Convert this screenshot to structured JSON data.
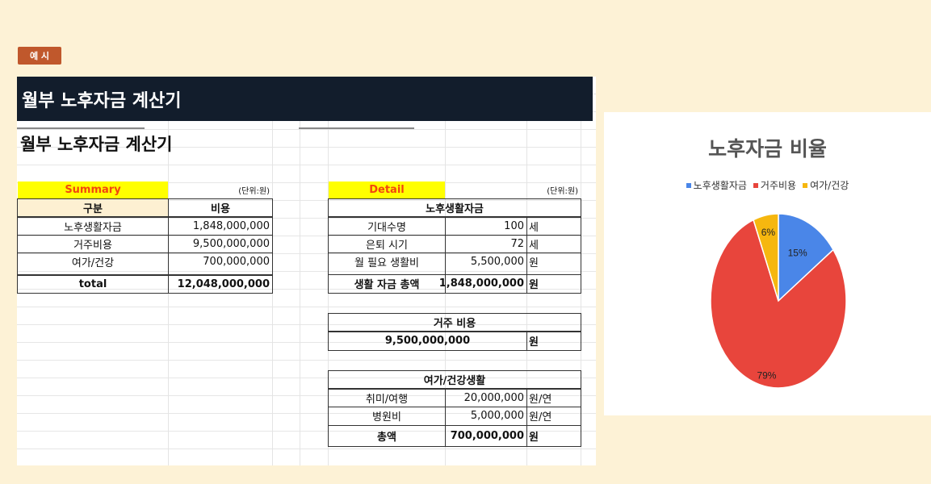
{
  "badge": "예 시",
  "sheet": {
    "banner_title": "월부 노후자금 계산기",
    "sub_title": "월부 노후자금 계산기"
  },
  "summary": {
    "header": "Summary",
    "unit": "(단위:원)",
    "col1": "구분",
    "col2": "비용",
    "rows": [
      {
        "label": "노후생활자금",
        "value": "1,848,000,000"
      },
      {
        "label": "거주비용",
        "value": "9,500,000,000"
      },
      {
        "label": "여가/건강",
        "value": "700,000,000"
      }
    ],
    "total_label": "total",
    "total_value": "12,048,000,000"
  },
  "detail": {
    "header": "Detail",
    "unit": "(단위:원)",
    "living": {
      "title": "노후생활자금",
      "rows": [
        {
          "label": "기대수명",
          "value": "100",
          "unit": "세"
        },
        {
          "label": "은퇴 시기",
          "value": "72",
          "unit": "세"
        },
        {
          "label": "월 필요 생활비",
          "value": "5,500,000",
          "unit": "원"
        }
      ],
      "total_label": "생활 자금 총액",
      "total_value": "1,848,000,000",
      "total_unit": "원"
    },
    "housing": {
      "title": "거주 비용",
      "value": "9,500,000,000",
      "unit": "원"
    },
    "leisure": {
      "title": "여가/건강생활",
      "rows": [
        {
          "label": "취미/여행",
          "value": "20,000,000",
          "unit": "원/연"
        },
        {
          "label": "병원비",
          "value": "5,000,000",
          "unit": "원/연"
        }
      ],
      "total_label": "총액",
      "total_value": "700,000,000",
      "total_unit": "원"
    }
  },
  "chart": {
    "title": "노후자금 비율",
    "colors": {
      "living": "#4a86e8",
      "housing": "#e8453c",
      "leisure": "#f6b70f"
    }
  },
  "chart_data": {
    "type": "pie",
    "title": "노후자금 비율",
    "categories": [
      "노후생활자금",
      "거주비용",
      "여가/건강"
    ],
    "values": [
      15,
      79,
      6
    ],
    "labels": [
      "15%",
      "79%",
      "6%"
    ],
    "colors": [
      "#4a86e8",
      "#e8453c",
      "#f6b70f"
    ],
    "legend": "top"
  }
}
